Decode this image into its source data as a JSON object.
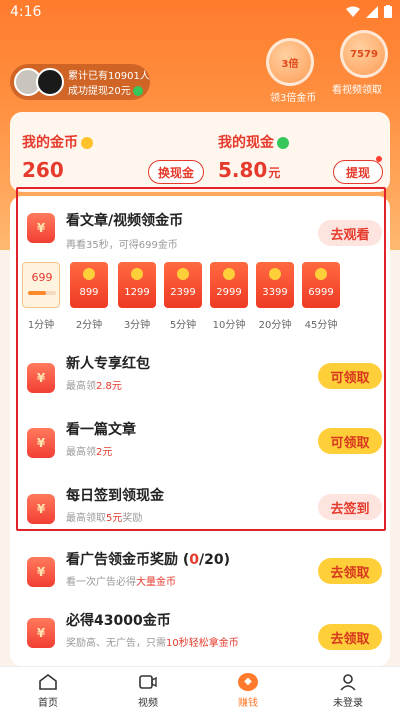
{
  "status_bar": {
    "time": "4:16"
  },
  "header": {
    "stats_line1": "累计已有10901人",
    "stats_line2": "成功提现20元",
    "bonus_badge": "3倍",
    "bonus_caption": "领3倍金币",
    "video_badge": "7579",
    "video_caption": "看视频领取"
  },
  "wallet": {
    "coins_label": "我的金币",
    "coins_value": "260",
    "exchange_button": "换现金",
    "cash_label": "我的现金",
    "cash_value": "5.80",
    "cash_unit": "元",
    "withdraw_button": "提现"
  },
  "tasks": [
    {
      "title": "看文章/视频领金币",
      "sub_prefix": "再看35秒，可得699金币",
      "sub_highlight": "",
      "sub_suffix": "",
      "action": "去观看"
    },
    {
      "title": "新人专享红包",
      "sub_prefix": "最高领",
      "sub_highlight": "2.8元",
      "sub_suffix": "",
      "action": "可领取"
    },
    {
      "title": "看一篇文章",
      "sub_prefix": "最高领",
      "sub_highlight": "2元",
      "sub_suffix": "",
      "action": "可领取"
    },
    {
      "title": "每日签到领现金",
      "sub_prefix": "最高领取",
      "sub_highlight": "5元",
      "sub_suffix": "奖励",
      "action": "去签到"
    },
    {
      "title": "看广告领金币奖励 (",
      "title_count": "0",
      "title_suffix": "/20)",
      "sub_prefix": "看一次广告必得",
      "sub_highlight": "大量金币",
      "sub_suffix": "",
      "action": "去领取"
    },
    {
      "title": "必得43000金币",
      "sub_prefix": "奖励高、无广告，只需",
      "sub_highlight": "10秒轻松拿金币",
      "sub_suffix": "",
      "action": "去领取"
    }
  ],
  "envelopes": [
    {
      "amount": "699",
      "label": "1分钟",
      "progress": 0.65
    },
    {
      "amount": "899",
      "label": "2分钟"
    },
    {
      "amount": "1299",
      "label": "3分钟"
    },
    {
      "amount": "2399",
      "label": "5分钟"
    },
    {
      "amount": "2999",
      "label": "10分钟"
    },
    {
      "amount": "3399",
      "label": "20分钟"
    },
    {
      "amount": "6999",
      "label": "45分钟"
    }
  ],
  "tabbar": {
    "home": "首页",
    "video": "视频",
    "earn": "赚钱",
    "profile": "未登录"
  },
  "colors": {
    "accent": "#ff7a2c",
    "red": "#e53a2c",
    "gold": "#ffcf3a"
  }
}
